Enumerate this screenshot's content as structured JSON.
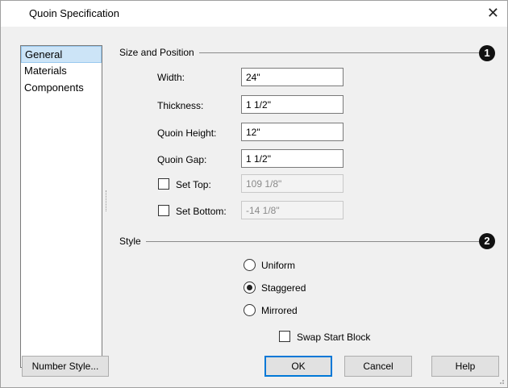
{
  "window": {
    "title": "Quoin Specification",
    "close_glyph": "✕"
  },
  "sidebar": {
    "items": [
      {
        "label": "General",
        "selected": true
      },
      {
        "label": "Materials",
        "selected": false
      },
      {
        "label": "Components",
        "selected": false
      }
    ]
  },
  "size_position": {
    "section_label": "Size and Position",
    "badge": "1",
    "width": {
      "label": "Width:",
      "value": "24\""
    },
    "thickness": {
      "label": "Thickness:",
      "value": "1 1/2\""
    },
    "quoin_height": {
      "label": "Quoin Height:",
      "value": "12\""
    },
    "quoin_gap": {
      "label": "Quoin Gap:",
      "value": "1 1/2\""
    },
    "set_top": {
      "label": "Set Top:",
      "checked": false,
      "value": "109 1/8\"",
      "enabled": false
    },
    "set_bottom": {
      "label": "Set Bottom:",
      "checked": false,
      "value": "-14 1/8\"",
      "enabled": false
    }
  },
  "style": {
    "section_label": "Style",
    "badge": "2",
    "options": [
      {
        "label": "Uniform",
        "selected": false
      },
      {
        "label": "Staggered",
        "selected": true
      },
      {
        "label": "Mirrored",
        "selected": false
      }
    ],
    "swap_start_block": {
      "label": "Swap Start Block",
      "checked": false
    }
  },
  "buttons": {
    "number_style": "Number Style...",
    "ok": "OK",
    "cancel": "Cancel",
    "help": "Help"
  },
  "colors": {
    "dialog_bg": "#f0f0f0",
    "selection_bg": "#cce4f7",
    "default_button_border": "#0078d7",
    "badge_bg": "#111111"
  }
}
